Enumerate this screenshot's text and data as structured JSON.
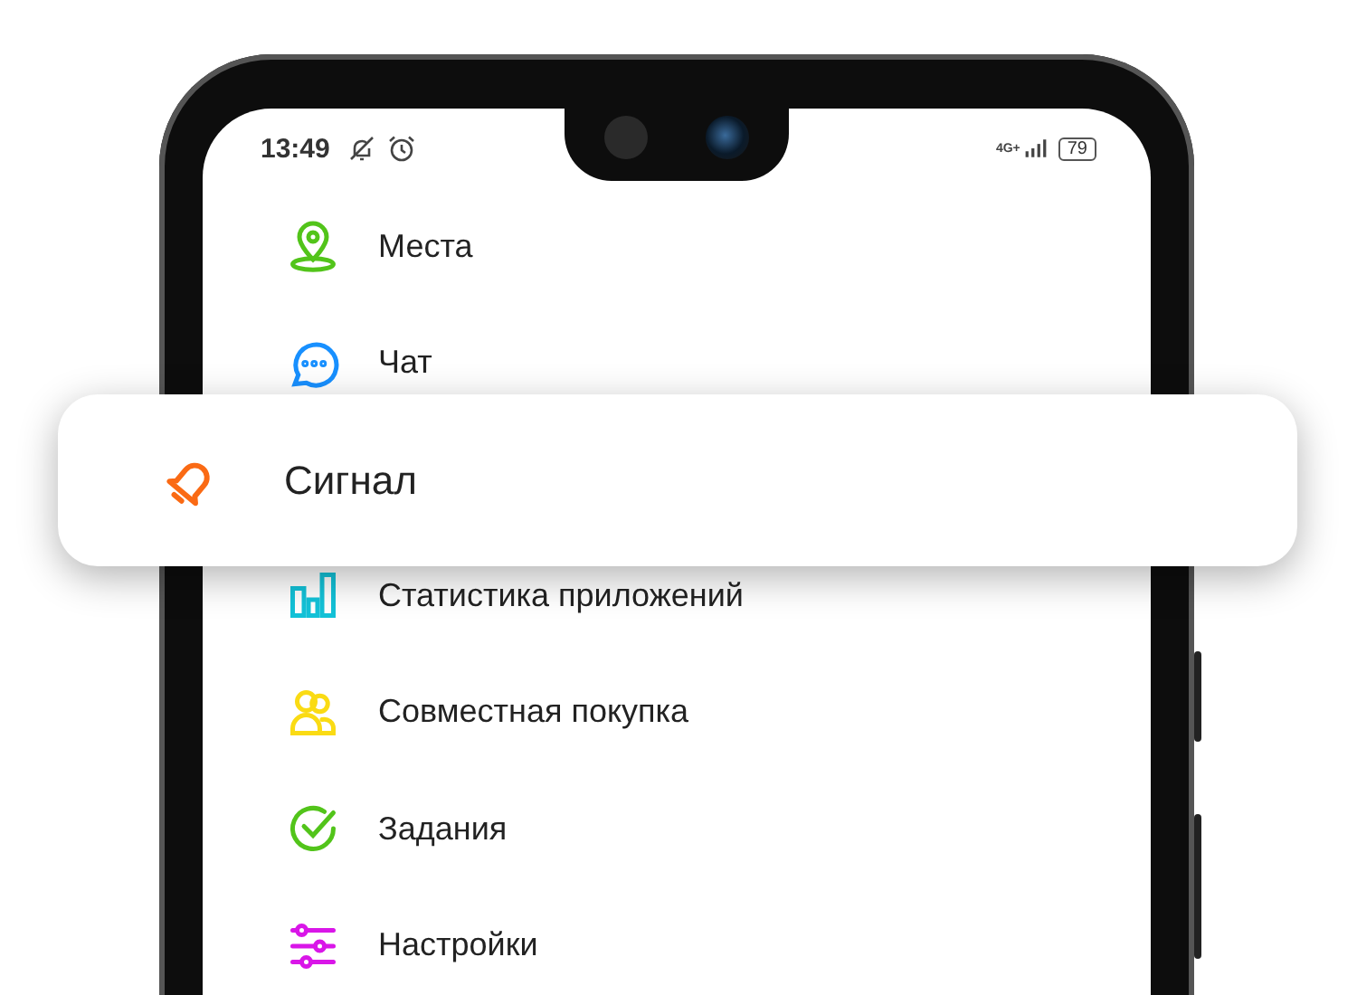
{
  "status_bar": {
    "time": "13:49",
    "network": "4G+",
    "battery": "79"
  },
  "menu": [
    {
      "label": "Места",
      "color": "#52c41a"
    },
    {
      "label": "Чат",
      "color": "#1890ff"
    },
    {
      "label": "Сигнал",
      "color": "#fa6a14",
      "selected": true
    },
    {
      "label": "Статистика приложений",
      "color": "#13c2d8"
    },
    {
      "label": "Совместная покупка",
      "color": "#fadb14"
    },
    {
      "label": "Задания",
      "color": "#52c41a"
    },
    {
      "label": "Настройки",
      "color": "#d916e8"
    }
  ]
}
